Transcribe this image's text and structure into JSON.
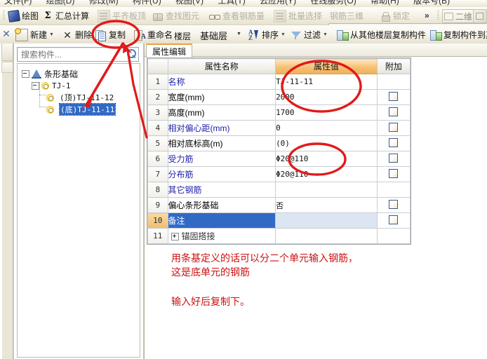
{
  "menubar": {
    "items": [
      "文件(F)",
      "绘图(D)",
      "修改(M)",
      "构件(U)",
      "视图(V)",
      "工具(T)",
      "云应用(Y)",
      "在线服务(O)",
      "帮助(H)",
      "版本号(B)"
    ]
  },
  "toolbar_main": {
    "buttons": [
      {
        "label": "绘图",
        "icon": "pencil-icon",
        "disabled": false
      },
      {
        "label": "汇总计算",
        "icon": "sigma-icon",
        "disabled": false
      },
      {
        "label": "平齐板顶",
        "icon": "align-slab-icon",
        "disabled": true
      },
      {
        "label": "查找图元",
        "icon": "binoculars-icon",
        "disabled": true
      },
      {
        "label": "查看钢筋量",
        "icon": "glasses-icon",
        "disabled": true
      },
      {
        "label": "批量选择",
        "icon": "batch-select-icon",
        "disabled": true
      },
      {
        "label": "钢筋三维",
        "icon": "rebar-3d-icon",
        "disabled": true
      },
      {
        "label": "锁定",
        "icon": "lock-icon",
        "disabled": true
      }
    ],
    "overflow_label": "»",
    "view_mode": {
      "label": "二维",
      "icon": "plane-icon",
      "arrow": "▼"
    },
    "cube_button": "cube-icon"
  },
  "toolbar_secondary": {
    "close_label": "✕",
    "buttons": [
      {
        "label": "新建",
        "icon": "new-icon",
        "has_dropdown": true
      },
      {
        "label": "删除",
        "icon": "delete-icon",
        "has_dropdown": false
      },
      {
        "label": "复制",
        "icon": "copy-icon",
        "has_dropdown": false
      },
      {
        "label": "重命名",
        "icon": "rename-icon",
        "has_dropdown": false
      }
    ],
    "floor_label": "楼层",
    "floor_value": "基础层",
    "floor_arrow": "▼",
    "sort_label": "排序",
    "sort_arrow": "▼",
    "filter_label": "过滤",
    "filter_arrow": "▼",
    "copy_from_other_floor": "从其他楼层复制构件",
    "copy_to_other": "复制构件到其"
  },
  "sidebar": {
    "search": {
      "value": "",
      "placeholder": "搜索构件...",
      "icon": "search-icon"
    },
    "tree": [
      {
        "label": "条形基础",
        "icon": "foundation-icon",
        "level": 0,
        "expander": "minus",
        "selected": false
      },
      {
        "label": "TJ-1",
        "icon": "gear-icon",
        "level": 1,
        "expander": "minus",
        "selected": false
      },
      {
        "label": "(顶)TJ-11-12",
        "icon": "gear-icon",
        "level": 2,
        "expander": "none",
        "selected": false
      },
      {
        "label": "(底)TJ-11-11",
        "icon": "gear-icon",
        "level": 2,
        "expander": "none",
        "selected": true
      }
    ]
  },
  "property_panel": {
    "tab_label": "属性编辑",
    "columns": [
      "",
      "属性名称",
      "属性值",
      "附加"
    ],
    "rows": [
      {
        "num": "1",
        "name": "名称",
        "name_color": "blue",
        "value": "TJ-11-11",
        "has_checkbox": false,
        "selected": false
      },
      {
        "num": "2",
        "name": "宽度(mm)",
        "name_color": "black",
        "value": "2000",
        "has_checkbox": true,
        "selected": false
      },
      {
        "num": "3",
        "name": "高度(mm)",
        "name_color": "black",
        "value": "1700",
        "has_checkbox": true,
        "selected": false
      },
      {
        "num": "4",
        "name": "相对偏心距(mm)",
        "name_color": "blue",
        "value": "0",
        "has_checkbox": true,
        "selected": false
      },
      {
        "num": "5",
        "name": "相对底标高(m)",
        "name_color": "black",
        "value": "(0)",
        "has_checkbox": true,
        "selected": false
      },
      {
        "num": "6",
        "name": "受力筋",
        "name_color": "blue",
        "value": "Φ20@110",
        "has_checkbox": true,
        "selected": false
      },
      {
        "num": "7",
        "name": "分布筋",
        "name_color": "blue",
        "value": "Φ20@110",
        "has_checkbox": true,
        "selected": false
      },
      {
        "num": "8",
        "name": "其它钢筋",
        "name_color": "blue",
        "value": "",
        "has_checkbox": false,
        "selected": false
      },
      {
        "num": "9",
        "name": "偏心条形基础",
        "name_color": "black",
        "value": "否",
        "has_checkbox": true,
        "selected": false
      },
      {
        "num": "10",
        "name": "备注",
        "name_color": "blue",
        "value": "",
        "has_checkbox": true,
        "selected": true
      },
      {
        "num": "11",
        "name": "锚固搭接",
        "name_color": "anchor",
        "value": "",
        "has_checkbox": false,
        "selected": false,
        "expandable": true
      }
    ]
  },
  "annotations": {
    "note1": "用条基定义的话可以分二个单元输入钢筋，\n这是底单元的钢筋",
    "note2": "输入好后复制下。",
    "color": "#cc1111"
  }
}
